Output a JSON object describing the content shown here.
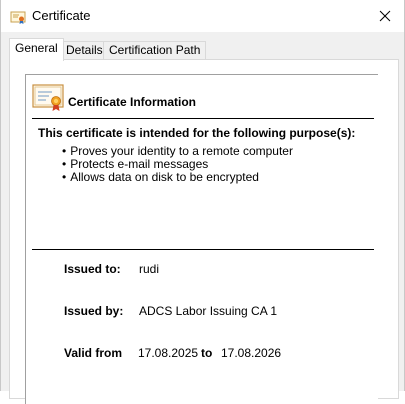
{
  "window": {
    "title": "Certificate",
    "title_icon": "certificate-icon",
    "close_icon": "close-icon"
  },
  "tabs": [
    {
      "label": "General",
      "active": true
    },
    {
      "label": "Details",
      "active": false
    },
    {
      "label": "Certification Path",
      "active": false
    }
  ],
  "info": {
    "title": "Certificate Information",
    "icon": "certificate-icon",
    "purpose_heading": "This certificate is intended for the following purpose(s):",
    "purposes": [
      "Proves your identity to a remote computer",
      "Protects e-mail messages",
      "Allows data on disk to be encrypted"
    ]
  },
  "fields": {
    "issued_to_label": "Issued to:",
    "issued_to_value": "rudi",
    "issued_by_label": "Issued by:",
    "issued_by_value": "ADCS Labor Issuing CA 1",
    "valid_from_label": "Valid from",
    "valid_from_value": "17.08.2025",
    "valid_to_label": "to",
    "valid_to_value": "17.08.2026"
  }
}
